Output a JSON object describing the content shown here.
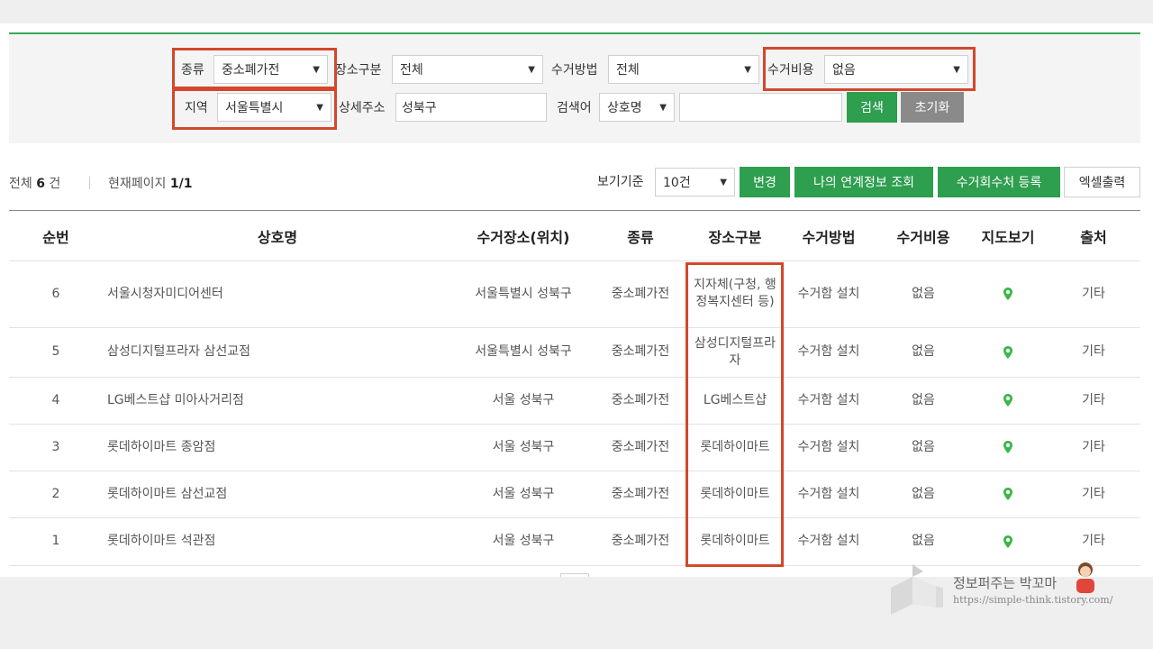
{
  "filters": {
    "type_label": "종류",
    "type_value": "중소폐가전",
    "place_label": "장소구분",
    "place_value": "전체",
    "method_label": "수거방법",
    "method_value": "전체",
    "cost_label": "수거비용",
    "cost_value": "없음",
    "region_label": "지역",
    "region_value": "서울특별시",
    "address_label": "상세주소",
    "address_value": "성북구",
    "keyword_label": "검색어",
    "keyword_type": "상호명",
    "keyword_value": "",
    "search_button": "검색",
    "reset_button": "초기화"
  },
  "summary": {
    "total_prefix": "전체",
    "total_count": "6",
    "total_suffix": "건",
    "page_label": "현재페이지",
    "page_value": "1/1"
  },
  "toolbar": {
    "view_label": "보기기준",
    "view_value": "10건",
    "change_button": "변경",
    "my_info_button": "나의 연계정보 조회",
    "register_button": "수거회수처 등록",
    "excel_button": "엑셀출력"
  },
  "table": {
    "headers": [
      "순번",
      "상호명",
      "수거장소(위치)",
      "종류",
      "장소구분",
      "수거방법",
      "수거비용",
      "지도보기",
      "출처"
    ],
    "rows": [
      {
        "no": "6",
        "name": "서울시청자미디어센터",
        "location": "서울특별시 성북구",
        "type": "중소폐가전",
        "place": "지자체(구청, 행정복지센터 등)",
        "method": "수거함 설치",
        "cost": "없음",
        "source": "기타"
      },
      {
        "no": "5",
        "name": "삼성디지털프라자 삼선교점",
        "location": "서울특별시 성북구",
        "type": "중소폐가전",
        "place": "삼성디지털프라자",
        "method": "수거함 설치",
        "cost": "없음",
        "source": "기타"
      },
      {
        "no": "4",
        "name": "LG베스트샵 미아사거리점",
        "location": "서울 성북구",
        "type": "중소폐가전",
        "place": "LG베스트샵",
        "method": "수거함 설치",
        "cost": "없음",
        "source": "기타"
      },
      {
        "no": "3",
        "name": "롯데하이마트 종암점",
        "location": "서울 성북구",
        "type": "중소폐가전",
        "place": "롯데하이마트",
        "method": "수거함 설치",
        "cost": "없음",
        "source": "기타"
      },
      {
        "no": "2",
        "name": "롯데하이마트 삼선교점",
        "location": "서울 성북구",
        "type": "중소폐가전",
        "place": "롯데하이마트",
        "method": "수거함 설치",
        "cost": "없음",
        "source": "기타"
      },
      {
        "no": "1",
        "name": "롯데하이마트 석관점",
        "location": "서울 성북구",
        "type": "중소폐가전",
        "place": "롯데하이마트",
        "method": "수거함 설치",
        "cost": "없음",
        "source": "기타"
      }
    ]
  },
  "watermark": {
    "title": "정보퍼주는 박꼬마",
    "url": "https://simple-think.tistory.com/"
  },
  "colors": {
    "accent_green": "#2e9e4f",
    "highlight_red": "#d4472b",
    "map_pin": "#3cb64a"
  },
  "icons": {
    "map": "map-pin-icon",
    "dropdown": "chevron-down-icon"
  }
}
